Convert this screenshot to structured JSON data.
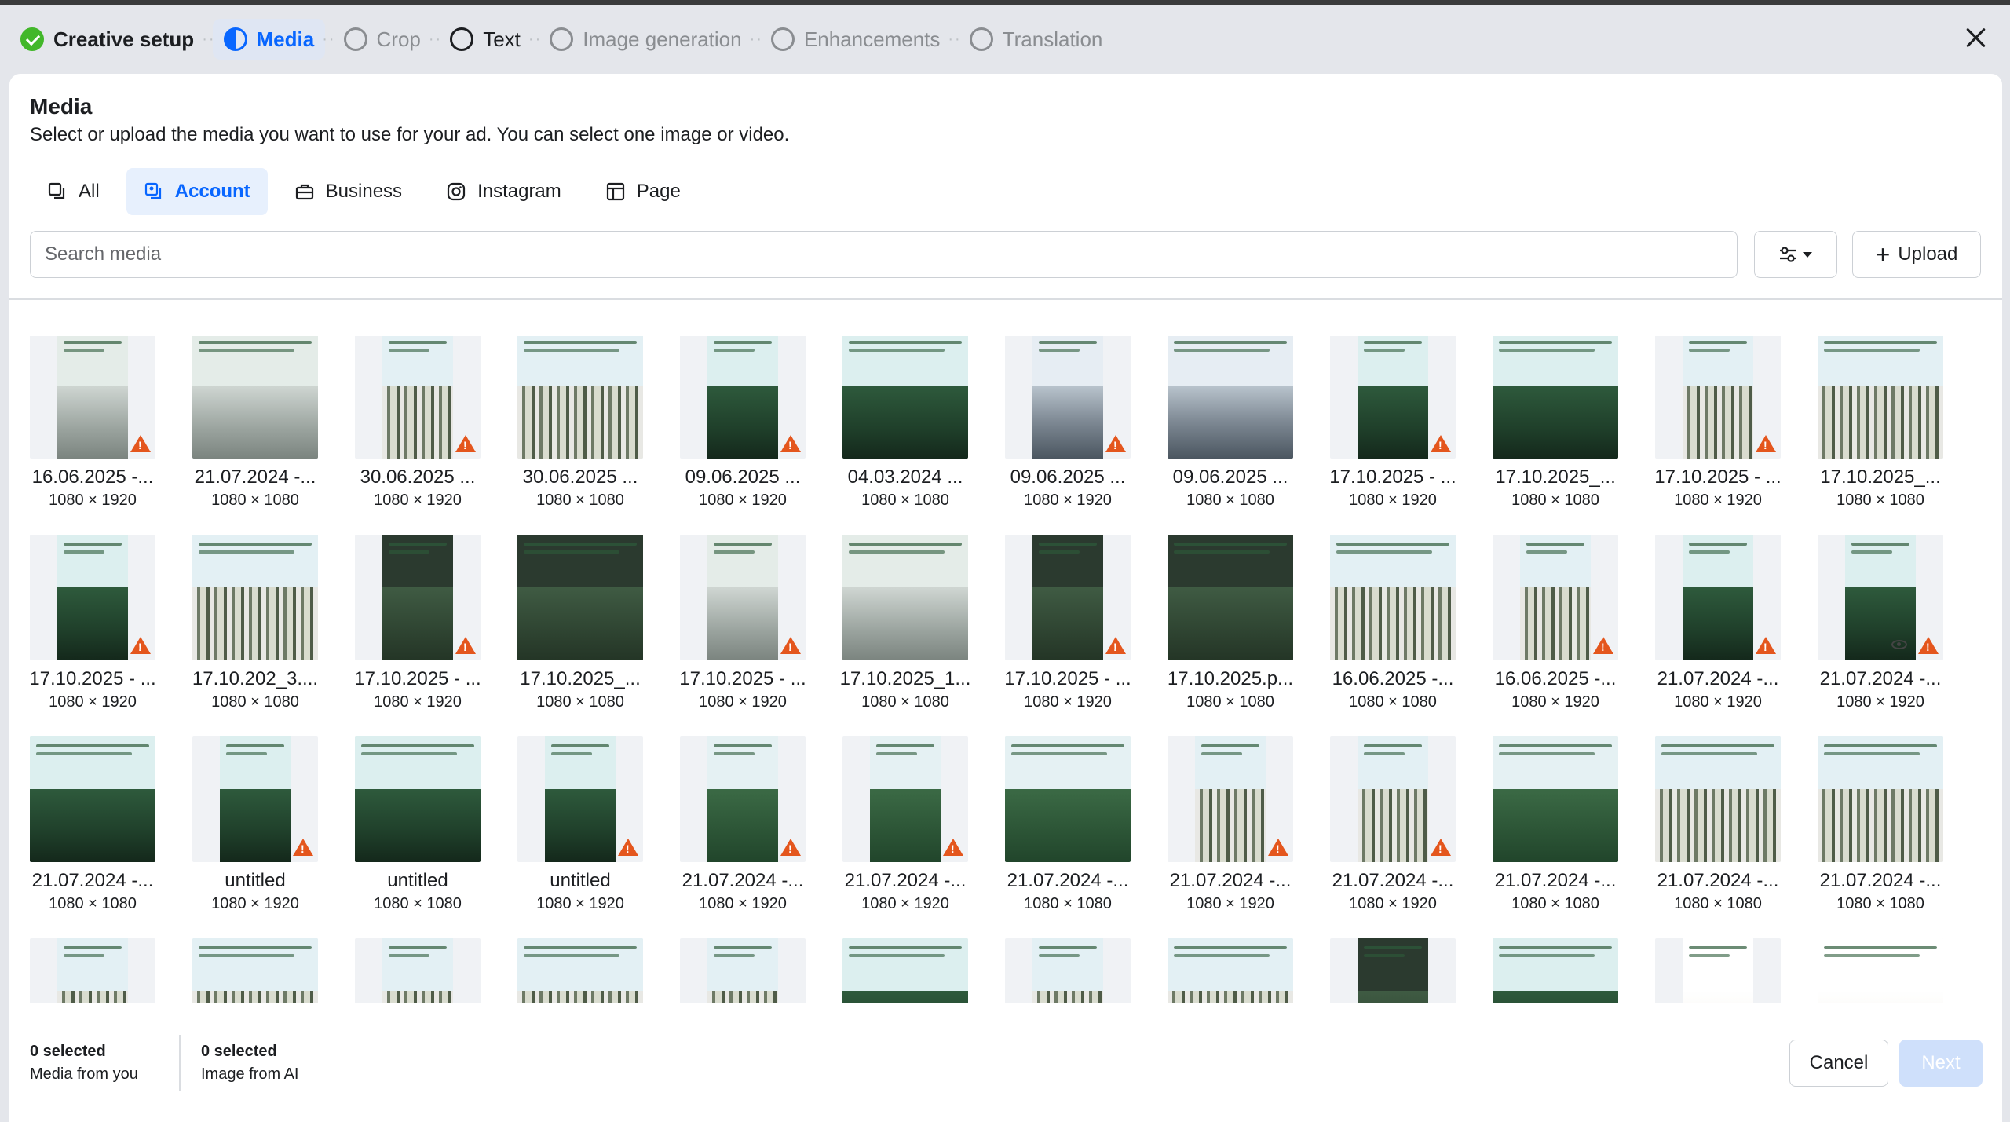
{
  "steps": [
    {
      "label": "Creative setup",
      "state": "done"
    },
    {
      "label": "Media",
      "state": "active"
    },
    {
      "label": "Crop",
      "state": "pending"
    },
    {
      "label": "Text",
      "state": "pending-dark"
    },
    {
      "label": "Image generation",
      "state": "pending"
    },
    {
      "label": "Enhancements",
      "state": "pending"
    },
    {
      "label": "Translation",
      "state": "pending"
    }
  ],
  "panel": {
    "title": "Media",
    "subtitle": "Select or upload the media you want to use for your ad. You can select one image or video."
  },
  "tabs": [
    {
      "label": "All",
      "icon": "all-media-icon",
      "active": false
    },
    {
      "label": "Account",
      "icon": "account-media-icon",
      "active": true
    },
    {
      "label": "Business",
      "icon": "briefcase-icon",
      "active": false
    },
    {
      "label": "Instagram",
      "icon": "instagram-icon",
      "active": false
    },
    {
      "label": "Page",
      "icon": "page-icon",
      "active": false
    }
  ],
  "search": {
    "placeholder": "Search media"
  },
  "upload_label": "Upload",
  "media": [
    [
      {
        "name": "16.06.2025 -...",
        "dim": "1080 × 1920",
        "portrait": true,
        "warn": true,
        "style": "fog"
      },
      {
        "name": "21.07.2024 -...",
        "dim": "1080 × 1080",
        "portrait": false,
        "warn": false,
        "style": "fog"
      },
      {
        "name": "30.06.2025 ...",
        "dim": "1080 × 1920",
        "portrait": true,
        "warn": true,
        "style": "birch"
      },
      {
        "name": "30.06.2025 ...",
        "dim": "1080 × 1080",
        "portrait": false,
        "warn": false,
        "style": "birch"
      },
      {
        "name": "09.06.2025 ...",
        "dim": "1080 × 1920",
        "portrait": true,
        "warn": true,
        "style": "green"
      },
      {
        "name": "04.03.2024 ...",
        "dim": "1080 × 1080",
        "portrait": false,
        "warn": false,
        "style": "green"
      },
      {
        "name": "09.06.2025 ...",
        "dim": "1080 × 1920",
        "portrait": true,
        "warn": true,
        "style": "city"
      },
      {
        "name": "09.06.2025 ...",
        "dim": "1080 × 1080",
        "portrait": false,
        "warn": false,
        "style": "city"
      },
      {
        "name": "17.10.2025 - ...",
        "dim": "1080 × 1920",
        "portrait": true,
        "warn": true,
        "style": "green"
      },
      {
        "name": "17.10.2025_...",
        "dim": "1080 × 1080",
        "portrait": false,
        "warn": false,
        "style": "green"
      },
      {
        "name": "17.10.2025 - ...",
        "dim": "1080 × 1920",
        "portrait": true,
        "warn": true,
        "style": "birch"
      },
      {
        "name": "17.10.2025_...",
        "dim": "1080 × 1080",
        "portrait": false,
        "warn": false,
        "style": "birch"
      }
    ],
    [
      {
        "name": "17.10.2025 - ...",
        "dim": "1080 × 1920",
        "portrait": true,
        "warn": true,
        "style": "green"
      },
      {
        "name": "17.10.202_3....",
        "dim": "1080 × 1080",
        "portrait": false,
        "warn": false,
        "style": "birch"
      },
      {
        "name": "17.10.2025 - ...",
        "dim": "1080 × 1920",
        "portrait": true,
        "warn": true,
        "style": "dark"
      },
      {
        "name": "17.10.2025_...",
        "dim": "1080 × 1080",
        "portrait": false,
        "warn": false,
        "style": "dark"
      },
      {
        "name": "17.10.2025 - ...",
        "dim": "1080 × 1920",
        "portrait": true,
        "warn": true,
        "style": "fog"
      },
      {
        "name": "17.10.2025_1...",
        "dim": "1080 × 1080",
        "portrait": false,
        "warn": false,
        "style": "fog"
      },
      {
        "name": "17.10.2025 - ...",
        "dim": "1080 × 1920",
        "portrait": true,
        "warn": true,
        "style": "dark"
      },
      {
        "name": "17.10.2025.p...",
        "dim": "1080 × 1080",
        "portrait": false,
        "warn": false,
        "style": "dark"
      },
      {
        "name": "16.06.2025 -...",
        "dim": "1080 × 1080",
        "portrait": false,
        "warn": false,
        "style": "birch"
      },
      {
        "name": "16.06.2025 -...",
        "dim": "1080 × 1920",
        "portrait": true,
        "warn": true,
        "style": "birch"
      },
      {
        "name": "21.07.2024 -...",
        "dim": "1080 × 1920",
        "portrait": true,
        "warn": true,
        "style": "green"
      },
      {
        "name": "21.07.2024 -...",
        "dim": "1080 × 1920",
        "portrait": true,
        "warn": true,
        "eye": true,
        "style": "green"
      }
    ],
    [
      {
        "name": "21.07.2024 -...",
        "dim": "1080 × 1080",
        "portrait": false,
        "warn": false,
        "style": "green"
      },
      {
        "name": "untitled",
        "dim": "1080 × 1920",
        "portrait": true,
        "warn": true,
        "style": "green"
      },
      {
        "name": "untitled",
        "dim": "1080 × 1080",
        "portrait": false,
        "warn": false,
        "style": "green"
      },
      {
        "name": "untitled",
        "dim": "1080 × 1920",
        "portrait": true,
        "warn": true,
        "style": "green"
      },
      {
        "name": "21.07.2024 -...",
        "dim": "1080 × 1920",
        "portrait": true,
        "warn": true,
        "style": "pine"
      },
      {
        "name": "21.07.2024 -...",
        "dim": "1080 × 1920",
        "portrait": true,
        "warn": true,
        "style": "pine"
      },
      {
        "name": "21.07.2024 -...",
        "dim": "1080 × 1080",
        "portrait": false,
        "warn": false,
        "style": "pine"
      },
      {
        "name": "21.07.2024 -...",
        "dim": "1080 × 1920",
        "portrait": true,
        "warn": true,
        "style": "birch"
      },
      {
        "name": "21.07.2024 -...",
        "dim": "1080 × 1920",
        "portrait": true,
        "warn": true,
        "style": "birch"
      },
      {
        "name": "21.07.2024 -...",
        "dim": "1080 × 1080",
        "portrait": false,
        "warn": false,
        "style": "pine"
      },
      {
        "name": "21.07.2024 -...",
        "dim": "1080 × 1080",
        "portrait": false,
        "warn": false,
        "style": "birch"
      },
      {
        "name": "21.07.2024 -...",
        "dim": "1080 × 1080",
        "portrait": false,
        "warn": false,
        "style": "birch"
      }
    ],
    [
      {
        "name": "",
        "dim": "",
        "portrait": true,
        "warn": false,
        "style": "birch"
      },
      {
        "name": "",
        "dim": "",
        "portrait": false,
        "warn": false,
        "style": "birch"
      },
      {
        "name": "",
        "dim": "",
        "portrait": true,
        "warn": false,
        "style": "birch"
      },
      {
        "name": "",
        "dim": "",
        "portrait": false,
        "warn": false,
        "style": "birch"
      },
      {
        "name": "",
        "dim": "",
        "portrait": true,
        "warn": false,
        "style": "birch"
      },
      {
        "name": "",
        "dim": "",
        "portrait": false,
        "warn": false,
        "style": "green"
      },
      {
        "name": "",
        "dim": "",
        "portrait": true,
        "warn": false,
        "style": "birch"
      },
      {
        "name": "",
        "dim": "",
        "portrait": false,
        "warn": false,
        "style": "birch"
      },
      {
        "name": "",
        "dim": "",
        "portrait": true,
        "warn": false,
        "style": "dark"
      },
      {
        "name": "",
        "dim": "",
        "portrait": false,
        "warn": false,
        "style": "green"
      },
      {
        "name": "",
        "dim": "",
        "portrait": true,
        "warn": false,
        "style": "text"
      },
      {
        "name": "",
        "dim": "",
        "portrait": false,
        "warn": false,
        "style": "text"
      }
    ]
  ],
  "footer": {
    "left_count": "0 selected",
    "left_label": "Media from you",
    "right_count": "0 selected",
    "right_label": "Image from AI",
    "cancel_label": "Cancel",
    "next_label": "Next"
  },
  "colors": {
    "accent": "#0866ff",
    "done": "#42b72a",
    "warning": "#e4561d"
  }
}
